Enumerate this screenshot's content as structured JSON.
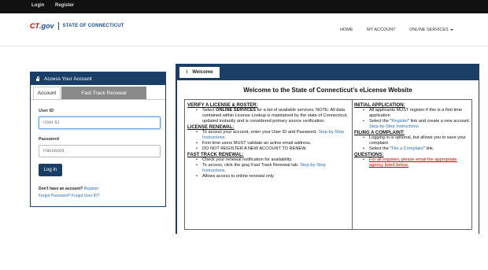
{
  "topbar": {
    "login": "Login",
    "register": "Register"
  },
  "logo": {
    "ct": "CT",
    "gov": ".gov",
    "state": "STATE OF CONNECTICUT"
  },
  "nav": {
    "home": "HOME",
    "my_account": "MY ACCOUNT",
    "online_services": "ONLINE SERVICES"
  },
  "access": {
    "title": "Access Your Account",
    "tab_account": "Account",
    "tab_fast": "Fast Track Renewal",
    "user_id_label": "User ID",
    "user_id_placeholder": "User ID",
    "password_label": "Password",
    "password_placeholder": "Password",
    "login_button": "Log In",
    "no_account": "Don't have an account?",
    "register_link": "Register",
    "forgot_password": "Forgot Password?",
    "forgot_user": "Forgot User ID?"
  },
  "welcome": {
    "tab_icon": "info-icon",
    "tab_label": "Welcome",
    "title": "Welcome to the State of Connecticut's eLicense Website",
    "verify": {
      "heading": "VERIFY A LICENSE & ROSTER:",
      "b1_pre": "Select ",
      "b1_bold": "ONLINE SERVICES",
      "b1_post": " for a list of available services. NOTE: All data contained within License Lookup is maintained by the state of Connecticut, updated instantly and is considered primary source verification."
    },
    "renewal": {
      "heading": "LICENSE RENEWAL:",
      "b1": "To access your account, enter your User ID and Password.",
      "b1_link": "Step-by-Step Instructions.",
      "b2": "First time users MUST validate an active email address.",
      "b3": "DO NOT REGISTER A NEW ACCOUNT TO RENEW."
    },
    "fast": {
      "heading": "FAST TRACK RENEWAL:",
      "b1": "Check your renewal notification for availability.",
      "b2": "To access, click the gray Fast Track Renewal tab.",
      "b2_link": "Step-by-Step Instructions.",
      "b3": "Allows access to online renewal only."
    },
    "initial": {
      "heading": "INITIAL APPLICATION:",
      "b1": "All applicants MUST register if this is a first time application",
      "b2_pre": "Select the \"",
      "b2_link": "Register",
      "b2_post": "\" link and create a new account.",
      "b2_link2": "Step-by-Step Instructions"
    },
    "complaint": {
      "heading": "FILING A COMPLAINT:",
      "b1": "Logging in is optional, but allows you to save your complaint",
      "b2_pre": "Select the \"",
      "b2_link": "File a Complaint",
      "b2_post": "\" link."
    },
    "questions": {
      "heading": "QUESTIONS:",
      "b1": "For all inquiries, please email the appropriate agency listed below."
    }
  }
}
